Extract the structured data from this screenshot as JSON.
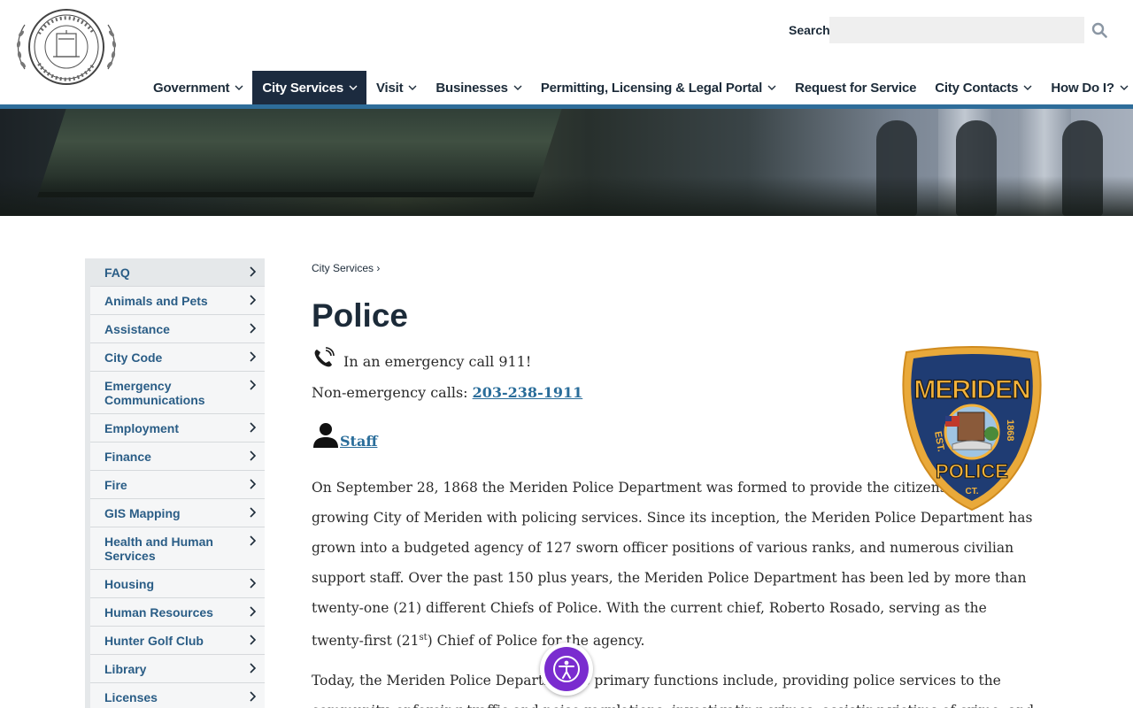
{
  "header": {
    "logo_alt": "City of Meriden seal",
    "search_label": "Search",
    "search_placeholder": ""
  },
  "nav": [
    {
      "label": "Government",
      "has_menu": true,
      "active": false
    },
    {
      "label": "City Services",
      "has_menu": true,
      "active": true
    },
    {
      "label": "Visit",
      "has_menu": true,
      "active": false
    },
    {
      "label": "Businesses",
      "has_menu": true,
      "active": false
    },
    {
      "label": "Permitting, Licensing & Legal Portal",
      "has_menu": true,
      "active": false
    },
    {
      "label": "Request for Service",
      "has_menu": false,
      "active": false
    },
    {
      "label": "City Contacts",
      "has_menu": true,
      "active": false
    },
    {
      "label": "How Do I?",
      "has_menu": true,
      "active": false
    }
  ],
  "sidebar": {
    "items": [
      "FAQ",
      "Animals and Pets",
      "Assistance",
      "City Code",
      "Emergency Communications",
      "Employment",
      "Finance",
      "Fire",
      "GIS Mapping",
      "Health and Human Services",
      "Housing",
      "Human Resources",
      "Hunter Golf Club",
      "Library",
      "Licenses"
    ]
  },
  "main": {
    "breadcrumb": "City Services",
    "breadcrumb_sep": "›",
    "title": "Police",
    "emergency_text": "In an emergency call 911!",
    "nonemergency_prefix": "Non-emergency calls: ",
    "nonemergency_phone": "203-238-1911",
    "staff_link": "Staff",
    "paragraph1_a": "On September 28, 1868 the Meriden Police Department was formed to provide the citizens of the growing City of Meriden with policing services.  Since its inception, the Meriden Police Department has grown into a budgeted agency of 127 sworn officer positions of various ranks, and numerous civilian support staff.  Over the past 150 plus years, the Meriden Police Department has been led by more than twenty-one (21) different Chiefs of Police. With the current chief, Roberto Rosado, serving as the twenty-first (21",
    "paragraph1_sup": "st",
    "paragraph1_b": ") Chief of Police for the agency.",
    "paragraph2": "Today, the Meriden Police Department's primary functions include, providing police services to the community, enforcing traffic and noise regulations, investigating crimes, assisting victims of crime, and"
  },
  "badge": {
    "top_text": "MERIDEN",
    "bottom_text": "POLICE",
    "est": "EST.",
    "year": "1868",
    "state": "CT."
  },
  "colors": {
    "accent": "#2e6d9a",
    "nav_active": "#1c2b3f",
    "link": "#2a6d9a",
    "accessibility": "#7a2ccf"
  },
  "icons": {
    "search": "search-icon",
    "phone": "phone-icon",
    "person": "person-icon",
    "accessibility": "accessibility-icon"
  }
}
